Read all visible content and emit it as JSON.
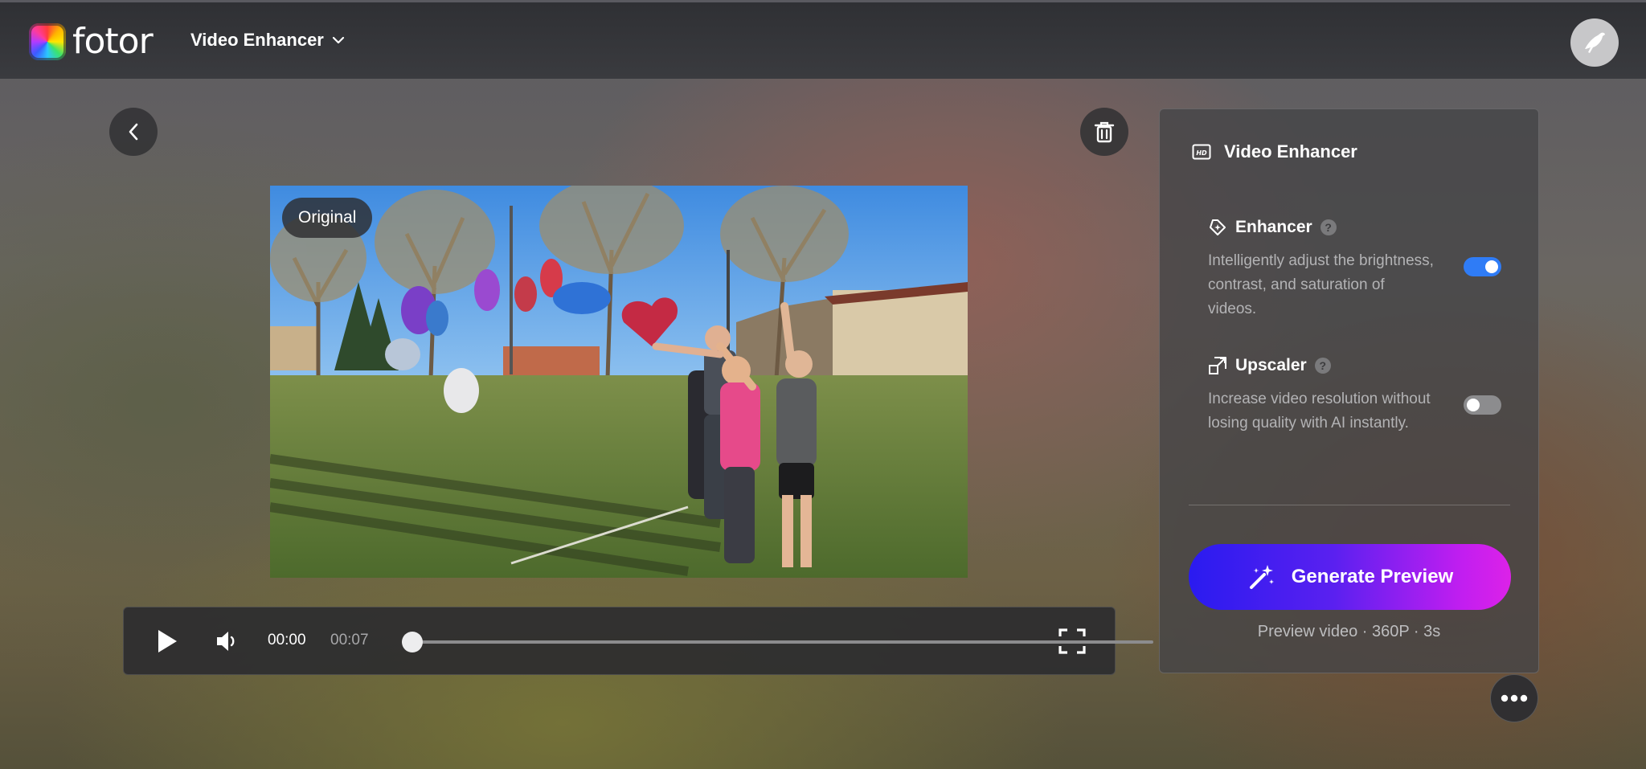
{
  "app": {
    "brand": "fotor",
    "product_menu_label": "Video Enhancer"
  },
  "video": {
    "badge": "Original",
    "current_time": "00:00",
    "duration": "00:07",
    "progress_fraction": 0.0
  },
  "panel": {
    "title": "Video Enhancer",
    "options": [
      {
        "title": "Enhancer",
        "description": "Intelligently adjust the brightness, contrast, and saturation of videos.",
        "enabled": true
      },
      {
        "title": "Upscaler",
        "description": "Increase video resolution without losing quality with AI instantly.",
        "enabled": false
      }
    ],
    "help_glyph": "?",
    "generate_label": "Generate Preview",
    "preview_info": "Preview video · 360P · 3s"
  },
  "colors": {
    "topbar": "#2f3034",
    "toggle_on": "#2f7cf6",
    "toggle_off": "#8c8c8e",
    "generate_gradient_start": "#2a1bf0",
    "generate_gradient_end": "#dc22e8"
  },
  "icons": {
    "logo": "fotor-logo-icon",
    "product_menu": "chevron-down-icon",
    "avatar": "bird-avatar-icon",
    "back": "chevron-left-icon",
    "delete": "trash-icon",
    "play": "play-icon",
    "volume": "volume-icon",
    "fullscreen": "fullscreen-icon",
    "panel_header": "hd-icon",
    "enhancer": "sparkle-badge-icon",
    "upscaler": "upscale-icon",
    "generate": "magic-wand-icon",
    "more": "more-dots-icon"
  }
}
